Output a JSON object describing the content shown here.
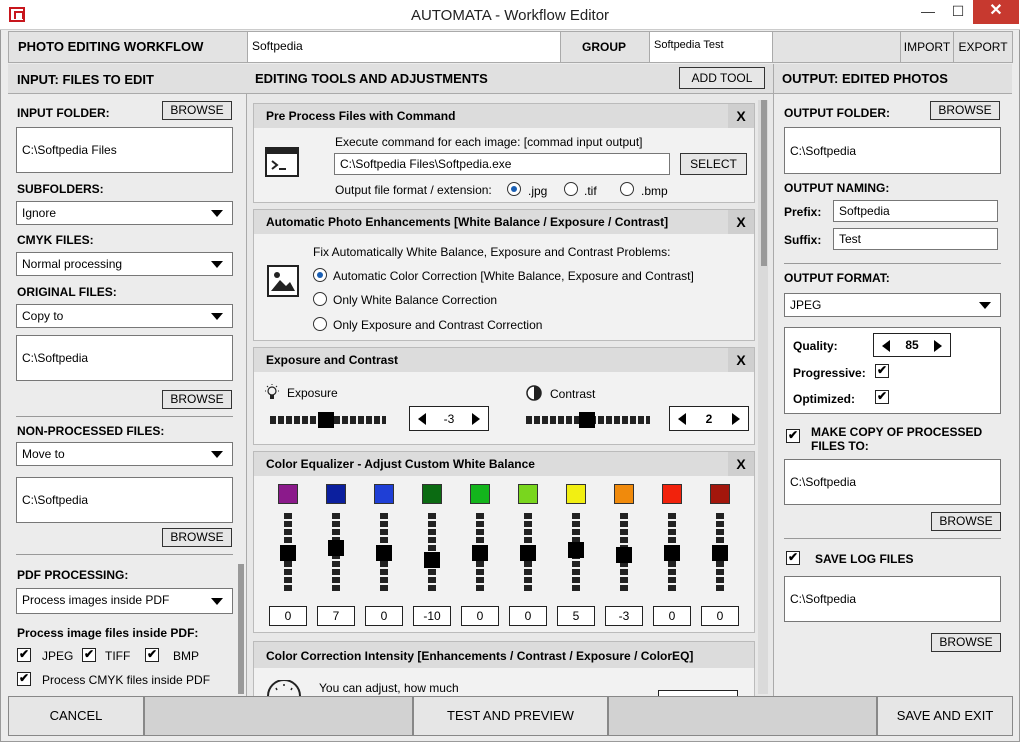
{
  "window": {
    "title": "AUTOMATA - Workflow Editor",
    "min": "—",
    "max": "☐",
    "close": "✕"
  },
  "top": {
    "workflow_label": "PHOTO EDITING WORKFLOW",
    "workflow_name": "Softpedia",
    "group_label": "GROUP",
    "group_value": "Softpedia Test",
    "import": "IMPORT",
    "export": "EXPORT"
  },
  "left": {
    "header": "INPUT: FILES TO EDIT",
    "input_folder_label": "INPUT FOLDER:",
    "browse": "BROWSE",
    "input_folder": "C:\\Softpedia Files",
    "subfolders_label": "SUBFOLDERS:",
    "subfolders": "Ignore",
    "cmyk_label": "CMYK FILES:",
    "cmyk": "Normal  processing",
    "original_label": "ORIGINAL FILES:",
    "original": "Copy to",
    "original_path": "C:\\Softpedia",
    "nonprocessed_label": "NON-PROCESSED FILES:",
    "nonprocessed": "Move to",
    "nonprocessed_path": "C:\\Softpedia",
    "pdf_label": "PDF PROCESSING:",
    "pdf": "Process images inside PDF",
    "process_label": "Process image files inside PDF:",
    "jpeg": "JPEG",
    "tiff": "TIFF",
    "bmp": "BMP",
    "cmyk_pdf": "Process CMYK files inside PDF",
    "check": "✔"
  },
  "center": {
    "header": "EDITING TOOLS AND ADJUSTMENTS",
    "add_tool": "ADD TOOL",
    "close": "X",
    "pre": {
      "title": "Pre Process Files with Command",
      "desc": "Execute command for each image: [commad input output]",
      "path": "C:\\Softpedia Files\\Softpedia.exe",
      "select": "SELECT",
      "format_label": "Output file format / extension:",
      "jpg": ".jpg",
      "tif": ".tif",
      "bmp": ".bmp"
    },
    "auto": {
      "title": "Automatic Photo Enhancements [White Balance / Exposure / Contrast]",
      "desc": "Fix Automatically White Balance, Exposure and Contrast Problems:",
      "opt1": "Automatic  Color Correction [White Balance, Exposure and Contrast]",
      "opt2": "Only White Balance Correction",
      "opt3": "Only Exposure and Contrast Correction"
    },
    "exp": {
      "title": "Exposure and Contrast",
      "exposure": "Exposure",
      "exposure_value": "-3",
      "contrast": "Contrast",
      "contrast_value": "2"
    },
    "eq": {
      "title": "Color Equalizer - Adjust Custom White Balance",
      "values": [
        "0",
        "7",
        "0",
        "-10",
        "0",
        "0",
        "5",
        "-3",
        "0",
        "0"
      ],
      "levels": [
        0,
        7,
        0,
        -10,
        0,
        0,
        5,
        -3,
        0,
        0
      ],
      "colors": [
        "#8b1a8b",
        "#0b1f9e",
        "#1f3fd6",
        "#0b6b12",
        "#13b51c",
        "#79d61e",
        "#f2ef12",
        "#f08a0c",
        "#f2220c",
        "#a3160c"
      ]
    },
    "cci": {
      "title": "Color Correction Intensity [Enhancements / Contrast / Exposure / ColorEQ]",
      "desc": "You can adjust, how much"
    }
  },
  "right": {
    "header": "OUTPUT: EDITED PHOTOS",
    "output_folder_label": "OUTPUT FOLDER:",
    "browse": "BROWSE",
    "output_folder": "C:\\Softpedia",
    "naming_label": "OUTPUT NAMING:",
    "prefix_label": "Prefix:",
    "prefix": "Softpedia",
    "suffix_label": "Suffix:",
    "suffix": "Test",
    "format_label": "OUTPUT FORMAT:",
    "format": "JPEG",
    "quality_label": "Quality:",
    "quality": "85",
    "progressive_label": "Progressive:",
    "optimized_label": "Optimized:",
    "copy_label": "MAKE COPY OF PROCESSED FILES TO:",
    "copy_path": "C:\\Softpedia",
    "log_label": "SAVE LOG FILES",
    "log_path": "C:\\Softpedia",
    "check": "✔"
  },
  "bottom": {
    "cancel": "CANCEL",
    "test": "TEST AND PREVIEW",
    "save": "SAVE AND EXIT"
  }
}
